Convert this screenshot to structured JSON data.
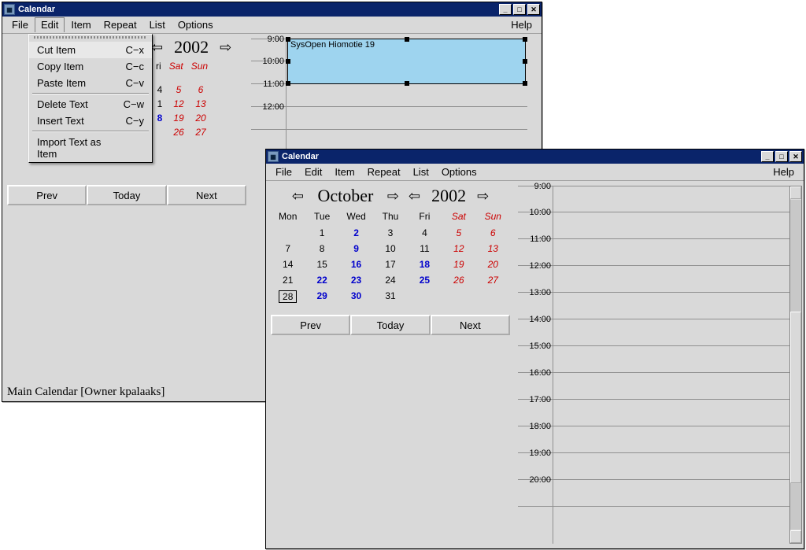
{
  "winA": {
    "title": "Calendar",
    "menu": {
      "file": "File",
      "edit": "Edit",
      "item": "Item",
      "repeat": "Repeat",
      "list": "List",
      "options": "Options",
      "help": "Help"
    },
    "year": "2002",
    "dow": {
      "sat": "Sat",
      "sun": "Sun"
    },
    "col5": [
      "5",
      "12",
      "19",
      "26"
    ],
    "col6": [
      "6",
      "13",
      "20",
      "27"
    ],
    "col4_8": "8",
    "nav": {
      "prev": "Prev",
      "today": "Today",
      "next": "Next"
    },
    "times": [
      "9:00",
      "10:00",
      "11:00",
      "12:00"
    ],
    "event": "SysOpen Hiomotie 19",
    "status": "Main Calendar [Owner kpalaaks]",
    "dropdown": {
      "cut": {
        "l": "Cut Item",
        "s": "C−x"
      },
      "copy": {
        "l": "Copy Item",
        "s": "C−c"
      },
      "paste": {
        "l": "Paste Item",
        "s": "C−v"
      },
      "deltext": {
        "l": "Delete Text",
        "s": "C−w"
      },
      "instext": {
        "l": "Insert Text",
        "s": "C−y"
      },
      "import": {
        "l": "Import Text as Item",
        "s": ""
      }
    },
    "frag": {
      "ri": "ri",
      "one": "1",
      "four": "4"
    }
  },
  "winB": {
    "title": "Calendar",
    "menu": {
      "file": "File",
      "edit": "Edit",
      "item": "Item",
      "repeat": "Repeat",
      "list": "List",
      "options": "Options",
      "help": "Help"
    },
    "month": "October",
    "year": "2002",
    "dow": {
      "mon": "Mon",
      "tue": "Tue",
      "wed": "Wed",
      "thu": "Thu",
      "fri": "Fri",
      "sat": "Sat",
      "sun": "Sun"
    },
    "grid": [
      [
        {
          "t": "",
          "c": ""
        },
        {
          "t": "1",
          "c": ""
        },
        {
          "t": "2",
          "c": "blue"
        },
        {
          "t": "3",
          "c": ""
        },
        {
          "t": "4",
          "c": ""
        },
        {
          "t": "5",
          "c": "red"
        },
        {
          "t": "6",
          "c": "red"
        }
      ],
      [
        {
          "t": "7",
          "c": ""
        },
        {
          "t": "8",
          "c": ""
        },
        {
          "t": "9",
          "c": "blue"
        },
        {
          "t": "10",
          "c": ""
        },
        {
          "t": "11",
          "c": ""
        },
        {
          "t": "12",
          "c": "red"
        },
        {
          "t": "13",
          "c": "red"
        }
      ],
      [
        {
          "t": "14",
          "c": ""
        },
        {
          "t": "15",
          "c": ""
        },
        {
          "t": "16",
          "c": "blue"
        },
        {
          "t": "17",
          "c": ""
        },
        {
          "t": "18",
          "c": "blue"
        },
        {
          "t": "19",
          "c": "red"
        },
        {
          "t": "20",
          "c": "red"
        }
      ],
      [
        {
          "t": "21",
          "c": ""
        },
        {
          "t": "22",
          "c": "blue"
        },
        {
          "t": "23",
          "c": "blue"
        },
        {
          "t": "24",
          "c": ""
        },
        {
          "t": "25",
          "c": "blue"
        },
        {
          "t": "26",
          "c": "red"
        },
        {
          "t": "27",
          "c": "red"
        }
      ],
      [
        {
          "t": "28",
          "c": "today"
        },
        {
          "t": "29",
          "c": "blue"
        },
        {
          "t": "30",
          "c": "blue"
        },
        {
          "t": "31",
          "c": ""
        },
        {
          "t": "",
          "c": ""
        },
        {
          "t": "",
          "c": ""
        },
        {
          "t": "",
          "c": ""
        }
      ]
    ],
    "nav": {
      "prev": "Prev",
      "today": "Today",
      "next": "Next"
    },
    "times": [
      "9:00",
      "10:00",
      "11:00",
      "12:00",
      "13:00",
      "14:00",
      "15:00",
      "16:00",
      "17:00",
      "18:00",
      "19:00",
      "20:00"
    ]
  }
}
